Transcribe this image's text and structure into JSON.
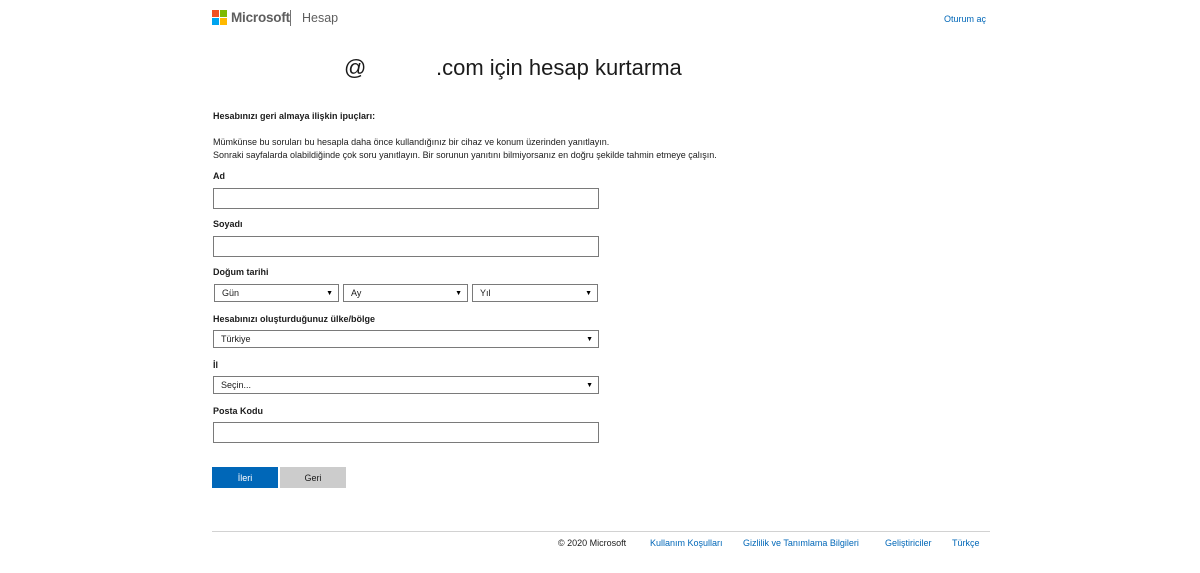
{
  "header": {
    "brand": "Microsoft",
    "product": "Hesap",
    "signin_label": "Oturum aç",
    "logo_colors": [
      "#f25022",
      "#7fba00",
      "#00a4ef",
      "#ffb900"
    ]
  },
  "title": {
    "at_sign": "@",
    "rest": ".com için hesap kurtarma"
  },
  "tips": {
    "heading": "Hesabınızı geri almaya ilişkin ipuçları:",
    "line1": "Mümkünse bu soruları bu hesapla daha önce kullandığınız bir cihaz ve konum üzerinden yanıtlayın.",
    "line2": "Sonraki sayfalarda olabildiğinde çok soru yanıtlayın. Bir sorunun yanıtını bilmiyorsanız en doğru şekilde tahmin etmeye çalışın."
  },
  "form": {
    "first_name": {
      "label": "Ad",
      "value": ""
    },
    "last_name": {
      "label": "Soyadı",
      "value": ""
    },
    "birth_date": {
      "label": "Doğum tarihi",
      "day": "Gün",
      "month": "Ay",
      "year": "Yıl"
    },
    "country": {
      "label": "Hesabınızı oluşturduğunuz ülke/bölge",
      "value": "Türkiye"
    },
    "province": {
      "label": "İl",
      "value": "Seçin..."
    },
    "postal_code": {
      "label": "Posta Kodu",
      "value": ""
    }
  },
  "buttons": {
    "next": "İleri",
    "back": "Geri"
  },
  "footer": {
    "copyright": "© 2020 Microsoft",
    "terms": "Kullanım Koşulları",
    "privacy": "Gizlilik ve Tanımlama Bilgileri",
    "developers": "Geliştiriciler",
    "language": "Türkçe"
  },
  "colors": {
    "accent": "#0067b8",
    "secondary_button": "#cccccc"
  }
}
